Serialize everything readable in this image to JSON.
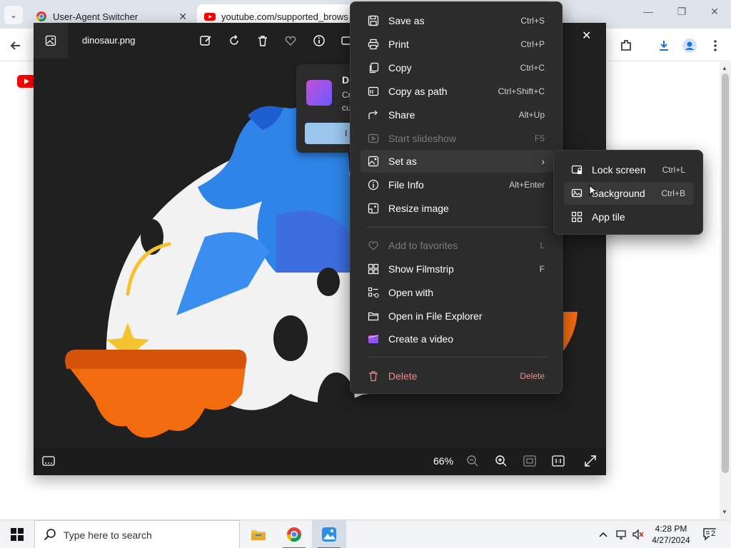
{
  "browser": {
    "tabs": [
      {
        "title": "User-Agent Switcher",
        "close": "✕"
      },
      {
        "title": "youtube.com/supported_brows"
      }
    ],
    "tab_menu_glyph": "⌄",
    "window_controls": {
      "minimize": "—",
      "restore": "❐",
      "close": "✕"
    }
  },
  "photos": {
    "filename": "dinosaur.png",
    "close": "✕",
    "zoom": "66%",
    "clipchamp_card": {
      "title": "D",
      "line1": "Cr",
      "line2": "cu",
      "button": "I"
    }
  },
  "context_menu": {
    "items": [
      {
        "label": "Save as",
        "shortcut": "Ctrl+S",
        "icon": "save-icon"
      },
      {
        "label": "Print",
        "shortcut": "Ctrl+P",
        "icon": "print-icon"
      },
      {
        "label": "Copy",
        "shortcut": "Ctrl+C",
        "icon": "copy-icon"
      },
      {
        "label": "Copy as path",
        "shortcut": "Ctrl+Shift+C",
        "icon": "copy-path-icon"
      },
      {
        "label": "Share",
        "shortcut": "Alt+Up",
        "icon": "share-icon"
      },
      {
        "label": "Start slideshow",
        "shortcut": "F5",
        "icon": "slideshow-icon",
        "disabled": true
      },
      {
        "label": "Set as",
        "shortcut": "",
        "icon": "set-as-icon",
        "submenu": true
      },
      {
        "label": "File Info",
        "shortcut": "Alt+Enter",
        "icon": "info-icon"
      },
      {
        "label": "Resize image",
        "shortcut": "",
        "icon": "resize-icon"
      },
      {
        "label": "Add to favorites",
        "shortcut": "L",
        "icon": "heart-icon",
        "disabled": true
      },
      {
        "label": "Show Filmstrip",
        "shortcut": "F",
        "icon": "filmstrip-icon"
      },
      {
        "label": "Open with",
        "shortcut": "",
        "icon": "open-with-icon"
      },
      {
        "label": "Open in File Explorer",
        "shortcut": "",
        "icon": "folder-icon"
      },
      {
        "label": "Create a video",
        "shortcut": "",
        "icon": "clipchamp-icon"
      },
      {
        "label": "Delete",
        "shortcut": "Delete",
        "icon": "trash-icon"
      }
    ]
  },
  "set_as_submenu": {
    "items": [
      {
        "label": "Lock screen",
        "shortcut": "Ctrl+L",
        "icon": "lock-screen-icon"
      },
      {
        "label": "Background",
        "shortcut": "Ctrl+B",
        "icon": "background-icon"
      },
      {
        "label": "App tile",
        "shortcut": "",
        "icon": "app-tile-icon"
      }
    ]
  },
  "taskbar": {
    "search_placeholder": "Type here to search",
    "time": "4:28 PM",
    "date": "4/27/2024",
    "notification_count": "2"
  },
  "colors": {
    "menu_bg": "#2c2c2c",
    "delete_red": "#f28b8b",
    "photos_bg": "#202020",
    "youtube_red": "#ff0000"
  }
}
